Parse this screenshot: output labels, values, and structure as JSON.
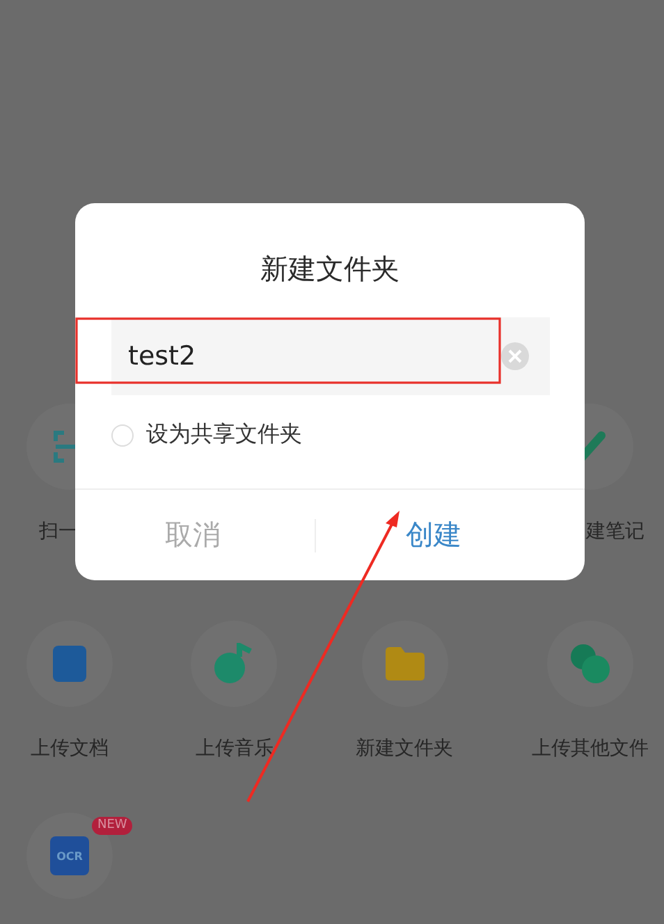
{
  "grid_rows": [
    {
      "items": [
        {
          "label": "扫一",
          "kind": "scan"
        },
        {
          "label": "建笔记",
          "kind": "pen"
        }
      ]
    },
    {
      "items": [
        {
          "label": "上传文档",
          "kind": "doc"
        },
        {
          "label": "上传音乐",
          "kind": "music"
        },
        {
          "label": "新建文件夹",
          "kind": "folder"
        },
        {
          "label": "上传其他文件",
          "kind": "other"
        }
      ]
    },
    {
      "items": [
        {
          "kind": "ocr",
          "icon_text": "OCR",
          "badge": "NEW"
        }
      ]
    }
  ],
  "dialog": {
    "title": "新建文件夹",
    "input": {
      "value": "test2"
    },
    "option": {
      "label": "设为共享文件夹",
      "checked": false
    },
    "buttons": [
      {
        "label": "取消",
        "kind": "cancel"
      },
      {
        "label": "创建",
        "kind": "confirm"
      }
    ]
  }
}
